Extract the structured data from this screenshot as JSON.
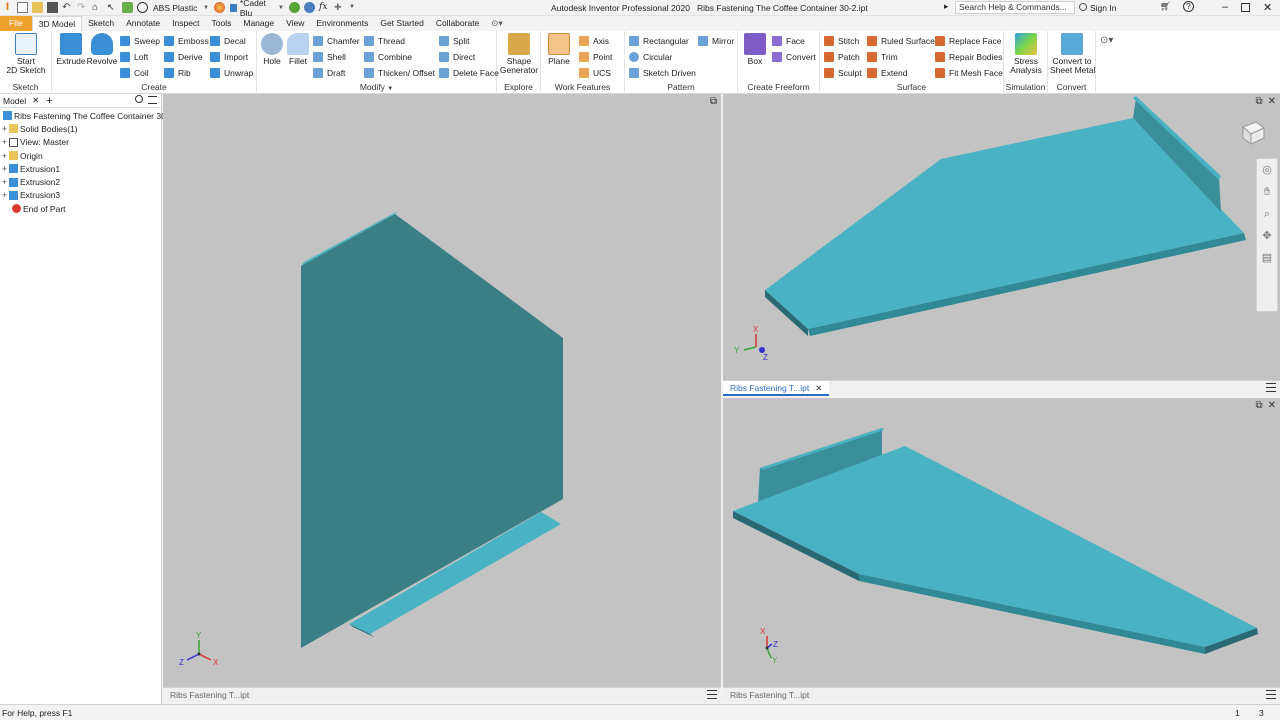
{
  "app": {
    "title": "Autodesk Inventor Professional 2020",
    "document": "Ribs Fastening The Coffee Container 30-2.ipt",
    "material": "ABS Plastic",
    "appearance": "*Cadet Blu",
    "search_placeholder": "Search Help & Commands...",
    "sign_in": "Sign In"
  },
  "menu_tabs": [
    "File",
    "3D Model",
    "Sketch",
    "Annotate",
    "Inspect",
    "Tools",
    "Manage",
    "View",
    "Environments",
    "Get Started",
    "Collaborate"
  ],
  "ribbon": {
    "sketch": {
      "group": "Sketch",
      "start1": "Start",
      "start2": "2D Sketch"
    },
    "create": {
      "group": "Create",
      "extrude": "Extrude",
      "revolve": "Revolve",
      "sweep": "Sweep",
      "emboss": "Emboss",
      "decal": "Decal",
      "loft": "Loft",
      "derive": "Derive",
      "import": "Import",
      "coil": "Coil",
      "rib": "Rib",
      "unwrap": "Unwrap"
    },
    "modify": {
      "group": "Modify",
      "hole": "Hole",
      "fillet": "Fillet",
      "chamfer": "Chamfer",
      "thread": "Thread",
      "split": "Split",
      "shell": "Shell",
      "combine": "Combine",
      "direct": "Direct",
      "draft": "Draft",
      "thicken": "Thicken/ Offset",
      "delete_face": "Delete Face"
    },
    "explore": {
      "group": "Explore",
      "shape1": "Shape",
      "shape2": "Generator"
    },
    "work": {
      "group": "Work Features",
      "plane": "Plane",
      "axis": "Axis",
      "point": "Point",
      "ucs": "UCS"
    },
    "pattern": {
      "group": "Pattern",
      "rectangular": "Rectangular",
      "circular": "Circular",
      "sketch_driven": "Sketch Driven",
      "mirror": "Mirror"
    },
    "freeform": {
      "group": "Create Freeform",
      "box": "Box",
      "face": "Face",
      "convert": "Convert"
    },
    "surface": {
      "group": "Surface",
      "stitch": "Stitch",
      "ruled": "Ruled Surface",
      "replace": "Replace Face",
      "patch": "Patch",
      "trim": "Trim",
      "repair": "Repair Bodies",
      "sculpt": "Sculpt",
      "extend": "Extend",
      "fit_mesh": "Fit Mesh Face"
    },
    "simulation": {
      "group": "Simulation",
      "stress1": "Stress",
      "stress2": "Analysis"
    },
    "convert": {
      "group": "Convert",
      "c1": "Convert to",
      "c2": "Sheet Metal"
    }
  },
  "browser": {
    "tab": "Model",
    "items": [
      {
        "label": "Ribs Fastening The Coffee Container 30-2.ipt"
      },
      {
        "label": "Solid Bodies(1)"
      },
      {
        "label": "View: Master"
      },
      {
        "label": "Origin"
      },
      {
        "label": "Extrusion1"
      },
      {
        "label": "Extrusion2"
      },
      {
        "label": "Extrusion3"
      },
      {
        "label": "End of Part"
      }
    ]
  },
  "doc_tabs": {
    "left": "Ribs Fastening T...ipt",
    "top_right": "Ribs Fastening T...ipt",
    "bottom_right": "Ribs Fastening T...ipt"
  },
  "axes": {
    "x": "X",
    "y": "Y",
    "z": "Z"
  },
  "status": {
    "help": "For Help, press F1",
    "count1": "1",
    "count2": "3"
  },
  "colors": {
    "model_front": "#3a7e86",
    "model_top": "#4ab3c3",
    "model_edge": "#2a6a74",
    "viewport_bg": "#c3c3c3",
    "file_tab": "#f0a22e",
    "accent": "#2a6fbf"
  }
}
